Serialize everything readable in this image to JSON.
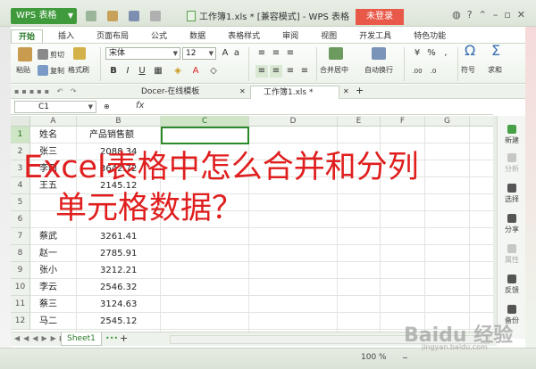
{
  "titlebar": {
    "app_button": "WPS 表格",
    "window_title": "工作簿1.xls * [兼容模式] - WPS 表格",
    "login_label": "未登录"
  },
  "ribbon_tabs": [
    "开始",
    "插入",
    "页面布局",
    "公式",
    "数据",
    "表格样式",
    "审阅",
    "视图",
    "开发工具",
    "特色功能"
  ],
  "ribbon": {
    "paste": "粘贴",
    "cut": "剪切",
    "copy": "复制",
    "format_painter": "格式刷",
    "font_name": "宋体",
    "font_size": "12",
    "merge_center": "合并居中",
    "wrap": "自动换行",
    "symbol": "符号",
    "sum": "求和",
    "percent": "%"
  },
  "doc_tabs": {
    "docer": "Docer-在线模板",
    "workbook": "工作簿1.xls *"
  },
  "formula_bar": {
    "name_box": "C1",
    "fx": "fx"
  },
  "columns": [
    "A",
    "B",
    "C",
    "D",
    "E",
    "F",
    "G"
  ],
  "rows": [
    {
      "n": "1",
      "a": "姓名",
      "b": "产品销售额"
    },
    {
      "n": "2",
      "a": "张三",
      "b": "2088.34"
    },
    {
      "n": "3",
      "a": "李四",
      "b": "3642.72"
    },
    {
      "n": "4",
      "a": "王五",
      "b": "2145.12"
    },
    {
      "n": "5",
      "a": "",
      "b": ""
    },
    {
      "n": "6",
      "a": "",
      "b": ""
    },
    {
      "n": "7",
      "a": "蔡武",
      "b": "3261.41"
    },
    {
      "n": "8",
      "a": "赵一",
      "b": "2785.91"
    },
    {
      "n": "9",
      "a": "张小",
      "b": "3212.21"
    },
    {
      "n": "10",
      "a": "李云",
      "b": "2546.32"
    },
    {
      "n": "11",
      "a": "蔡三",
      "b": "3124.63"
    },
    {
      "n": "12",
      "a": "马二",
      "b": "2545.12"
    }
  ],
  "sheet_tab": "Sheet1",
  "status": {
    "zoom": "100 %"
  },
  "task_pane": [
    "新建",
    "分析",
    "选择",
    "分享",
    "属性",
    "反馈",
    "备份"
  ],
  "overlay": {
    "line1": "Excel表格中怎么合并和分列",
    "line2": "单元格数据？"
  },
  "watermark": {
    "main": "Baidu 经验",
    "sub": "jingyan.baidu.com"
  },
  "colors": {
    "accent_green": "#3f9a3c",
    "login_red": "#e8594a",
    "overlay_red": "#e01e1e"
  }
}
